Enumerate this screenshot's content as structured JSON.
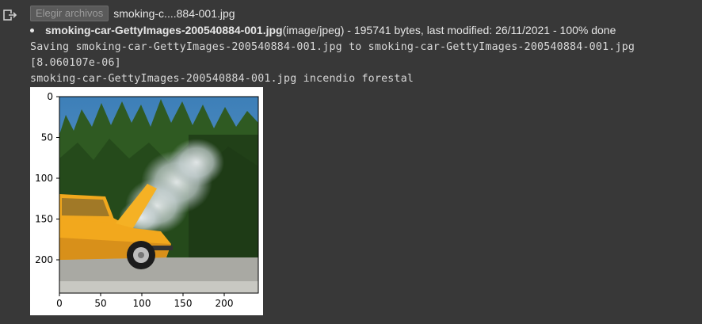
{
  "output_icon": "output-arrow-icon",
  "file_input": {
    "button_label": "Elegir archivos",
    "chosen_file": "smoking-c....884-001.jpg"
  },
  "upload_item": {
    "filename": "smoking-car-GettyImages-200540884-001.jpg",
    "details": "(image/jpeg) - 195741 bytes, last modified: 26/11/2021 - 100% done"
  },
  "output_lines": [
    "Saving smoking-car-GettyImages-200540884-001.jpg to smoking-car-GettyImages-200540884-001.jpg",
    "[8.060107e-06]",
    "smoking-car-GettyImages-200540884-001.jpg incendio forestal"
  ],
  "plot": {
    "image_subject": "smoking yellow car with open hood in front of trees",
    "x_ticks": [
      "0",
      "50",
      "100",
      "150",
      "200"
    ],
    "y_ticks": [
      "0",
      "50",
      "100",
      "150",
      "200"
    ]
  }
}
